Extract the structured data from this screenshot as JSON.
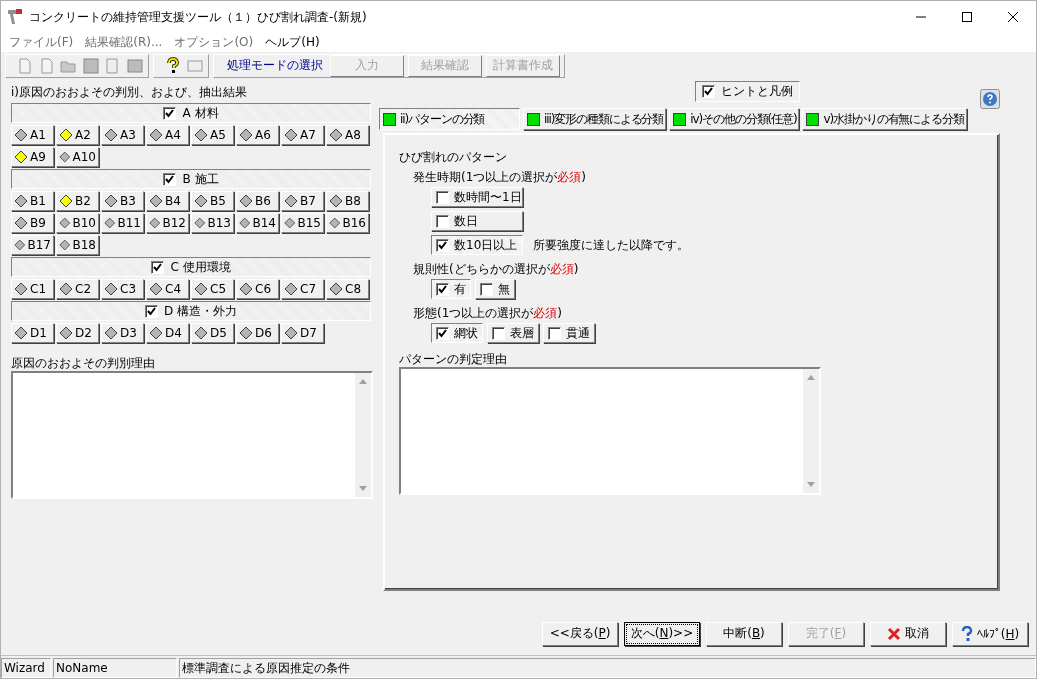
{
  "window": {
    "title": "コンクリートの維持管理支援ツール（１）ひび割れ調査-(新規)"
  },
  "menu": [
    {
      "label": "ファイル(F)",
      "disabled": true
    },
    {
      "label": "結果確認(R)...",
      "disabled": true
    },
    {
      "label": "オプション(O)",
      "disabled": true
    },
    {
      "label": "ヘルプ(H)",
      "disabled": false
    }
  ],
  "toolbar": {
    "mode_label": "処理モードの選択",
    "mode_buttons": [
      {
        "label": "入力",
        "disabled": true
      },
      {
        "label": "結果確認",
        "disabled": true
      },
      {
        "label": "計算書作成",
        "disabled": true
      }
    ]
  },
  "cause_panel": {
    "title": "i)原因のおおよその判別、および、抽出結果",
    "groups": [
      {
        "label": "A 材料",
        "checked": true,
        "items": [
          {
            "label": "A1",
            "selected": false
          },
          {
            "label": "A2",
            "selected": true
          },
          {
            "label": "A3",
            "selected": false
          },
          {
            "label": "A4",
            "selected": false
          },
          {
            "label": "A5",
            "selected": false
          },
          {
            "label": "A6",
            "selected": false
          },
          {
            "label": "A7",
            "selected": false
          },
          {
            "label": "A8",
            "selected": false
          },
          {
            "label": "A9",
            "selected": true
          },
          {
            "label": "A10",
            "selected": false
          }
        ]
      },
      {
        "label": "B 施工",
        "checked": true,
        "items": [
          {
            "label": "B1",
            "selected": false
          },
          {
            "label": "B2",
            "selected": true
          },
          {
            "label": "B3",
            "selected": false
          },
          {
            "label": "B4",
            "selected": false
          },
          {
            "label": "B5",
            "selected": false
          },
          {
            "label": "B6",
            "selected": false
          },
          {
            "label": "B7",
            "selected": false
          },
          {
            "label": "B8",
            "selected": false
          },
          {
            "label": "B9",
            "selected": false
          },
          {
            "label": "B10",
            "selected": false
          },
          {
            "label": "B11",
            "selected": false
          },
          {
            "label": "B12",
            "selected": false
          },
          {
            "label": "B13",
            "selected": false
          },
          {
            "label": "B14",
            "selected": false
          },
          {
            "label": "B15",
            "selected": false
          },
          {
            "label": "B16",
            "selected": false
          },
          {
            "label": "B17",
            "selected": false
          },
          {
            "label": "B18",
            "selected": false
          }
        ]
      },
      {
        "label": "C 使用環境",
        "checked": true,
        "items": [
          {
            "label": "C1",
            "selected": false
          },
          {
            "label": "C2",
            "selected": false
          },
          {
            "label": "C3",
            "selected": false
          },
          {
            "label": "C4",
            "selected": false
          },
          {
            "label": "C5",
            "selected": false
          },
          {
            "label": "C6",
            "selected": false
          },
          {
            "label": "C7",
            "selected": false
          },
          {
            "label": "C8",
            "selected": false
          }
        ]
      },
      {
        "label": "D 構造・外力",
        "checked": true,
        "items": [
          {
            "label": "D1",
            "selected": false
          },
          {
            "label": "D2",
            "selected": false
          },
          {
            "label": "D3",
            "selected": false
          },
          {
            "label": "D4",
            "selected": false
          },
          {
            "label": "D5",
            "selected": false
          },
          {
            "label": "D6",
            "selected": false
          },
          {
            "label": "D7",
            "selected": false
          }
        ]
      }
    ],
    "reason_label": "原因のおおよその判別理由"
  },
  "hint_toggle": {
    "label": "ヒントと凡例",
    "checked": true
  },
  "tabs": [
    {
      "label": "ii)パターンの分類",
      "selected": true
    },
    {
      "label": "iii)変形の種類による分類",
      "selected": false
    },
    {
      "label": "iv)その他の分類(任意)",
      "selected": false
    },
    {
      "label": "v)水掛かりの有無による分類",
      "selected": false
    }
  ],
  "pattern": {
    "title": "ひび割れのパターン",
    "sections": [
      {
        "kind": "column",
        "label": "発生時期(1つ以上の選択が",
        "required": "必須",
        "label_end": ")",
        "options": [
          {
            "label": "数時間〜1日",
            "checked": false
          },
          {
            "label": "数日",
            "checked": false
          },
          {
            "label": "数10日以上",
            "checked": true,
            "note": "所要強度に達した以降です。"
          }
        ]
      },
      {
        "kind": "row",
        "label": "規則性(どちらかの選択が",
        "required": "必須",
        "label_end": ")",
        "options": [
          {
            "label": "有",
            "checked": true
          },
          {
            "label": "無",
            "checked": false
          }
        ]
      },
      {
        "kind": "row",
        "label": "形態(1つ以上の選択が",
        "required": "必須",
        "label_end": ")",
        "options": [
          {
            "label": "網状",
            "checked": true
          },
          {
            "label": "表層",
            "checked": false
          },
          {
            "label": "貫通",
            "checked": false
          }
        ]
      }
    ],
    "reason_label": "パターンの判定理由"
  },
  "footer_buttons": [
    {
      "kind": "plain",
      "text": "<<戻る(",
      "key": "P",
      "tail": ")",
      "focused": false,
      "disabled": false
    },
    {
      "kind": "plain",
      "text": "次へ(",
      "key": "N",
      "tail": ")>>",
      "focused": true,
      "disabled": false
    },
    {
      "kind": "plain",
      "text": "中断(",
      "key": "B",
      "tail": ")",
      "focused": false,
      "disabled": false
    },
    {
      "kind": "plain",
      "text": "完了(",
      "key": "F",
      "tail": ")",
      "focused": false,
      "disabled": true
    },
    {
      "kind": "cancel",
      "text": "取消",
      "focused": false,
      "disabled": false
    },
    {
      "kind": "help",
      "text": "ﾍﾙﾌﾟ(",
      "key": "H",
      "tail": ")",
      "focused": false,
      "disabled": false
    }
  ],
  "status_bar": [
    "Wizard",
    "NoName",
    "標準調査による原因推定の条件"
  ]
}
